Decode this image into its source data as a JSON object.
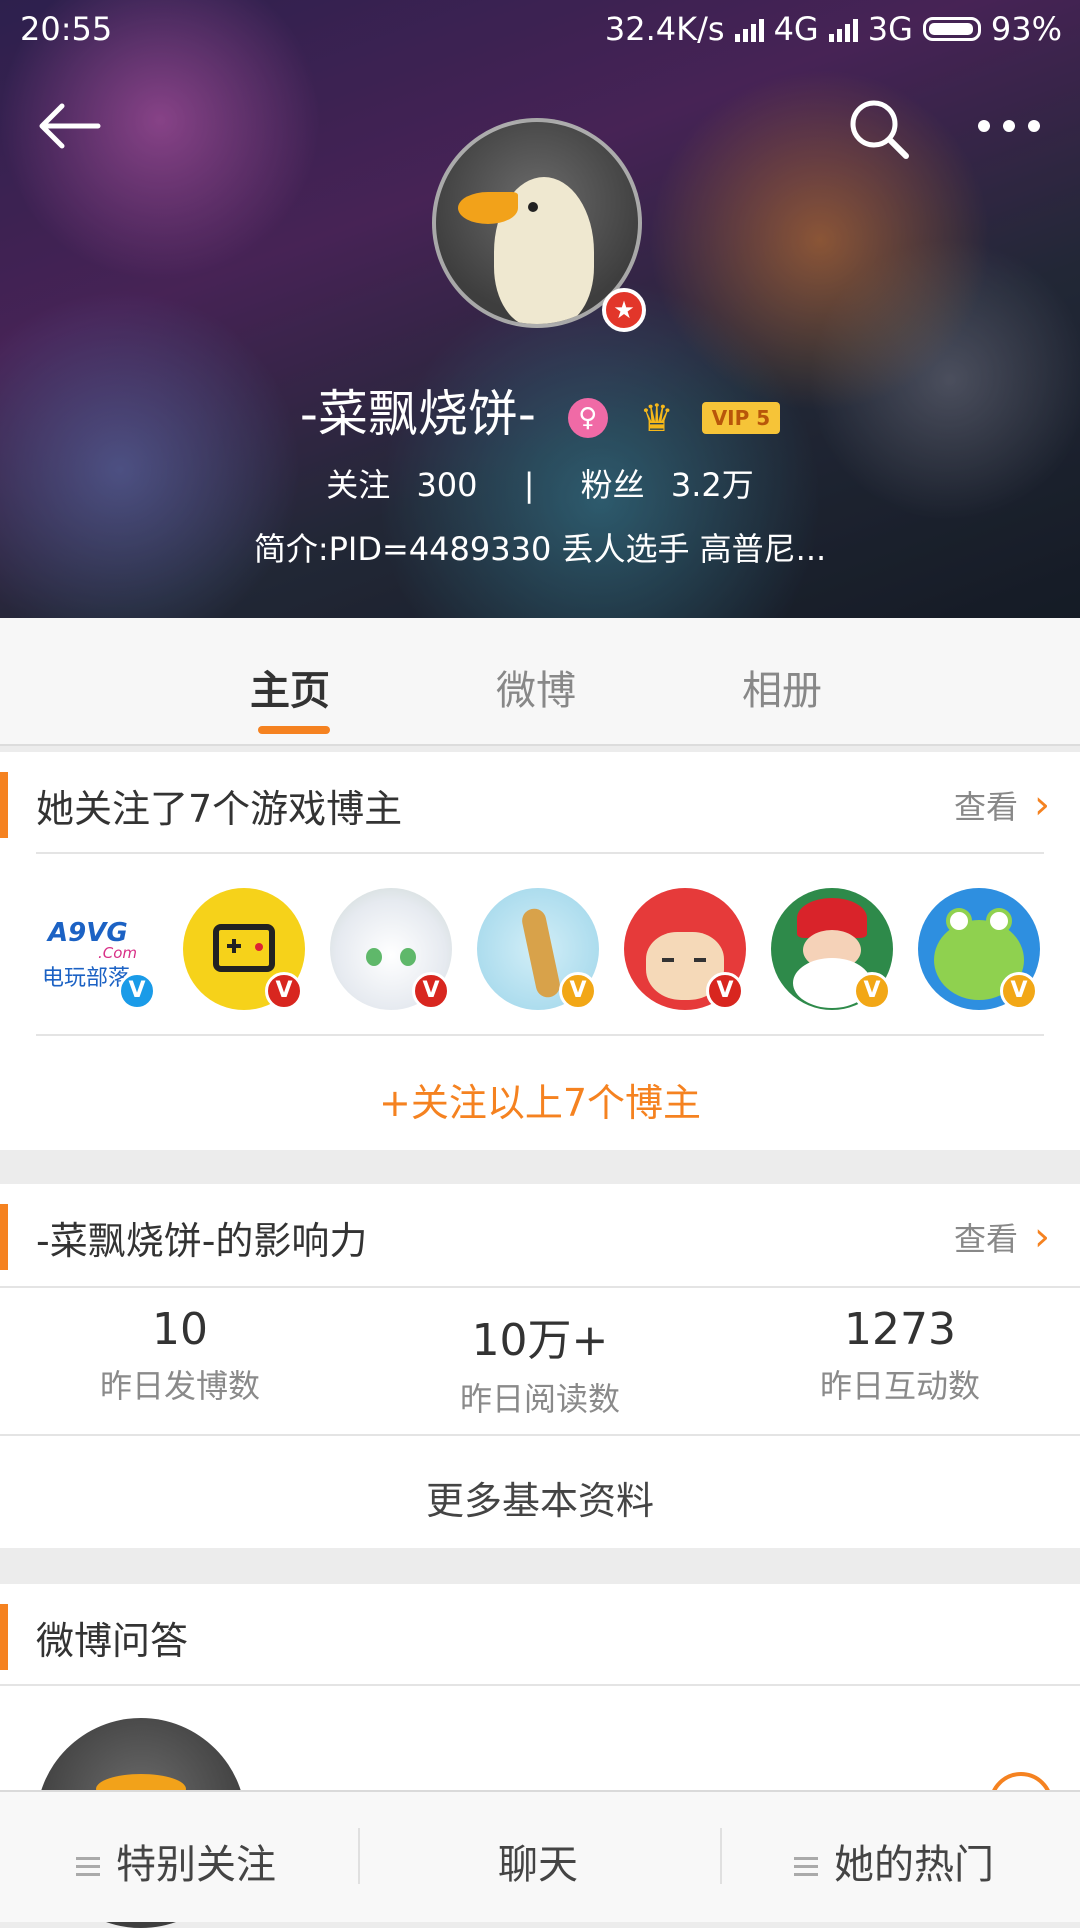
{
  "status_bar": {
    "time": "20:55",
    "speed": "32.4K/s",
    "net1": "4G",
    "net2": "3G",
    "battery": "93%"
  },
  "profile": {
    "name": "-菜飘烧饼-",
    "vip_label": "VIP 5",
    "following_label": "关注",
    "following_count": "300",
    "fans_label": "粉丝",
    "fans_count": "3.2万",
    "bio": "简介:PID=4489330 丢人选手 高普尼..."
  },
  "tabs": [
    {
      "label": "主页"
    },
    {
      "label": "微博"
    },
    {
      "label": "相册"
    }
  ],
  "follow_section": {
    "title": "她关注了7个游戏博主",
    "more": "查看",
    "cta": "+关注以上7个博主",
    "bloggers": [
      {
        "name": "A9VG",
        "badge": "blue"
      },
      {
        "name": "gamepad",
        "badge": "red"
      },
      {
        "name": "anime-girl",
        "badge": "red"
      },
      {
        "name": "dragon",
        "badge": "gold"
      },
      {
        "name": "red-cat",
        "badge": "red"
      },
      {
        "name": "santa",
        "badge": "gold"
      },
      {
        "name": "frog",
        "badge": "gold"
      }
    ],
    "logo_text_1": "A9VG",
    "logo_text_2": ".Com",
    "logo_text_3": "电玩部落"
  },
  "influence": {
    "title": "-菜飘烧饼-的影响力",
    "more": "查看",
    "metrics": [
      {
        "value": "10",
        "label": "昨日发博数"
      },
      {
        "value": "10万+",
        "label": "昨日阅读数"
      },
      {
        "value": "1273",
        "label": "昨日互动数"
      }
    ],
    "more_basic": "更多基本资料"
  },
  "qa": {
    "title": "微博问答"
  },
  "bottom_bar": [
    {
      "label": "特别关注"
    },
    {
      "label": "聊天"
    },
    {
      "label": "她的热门"
    }
  ],
  "colors": {
    "accent": "#f58220",
    "verified_blue": "#1a9be8",
    "verified_red": "#d8261f",
    "verified_gold": "#f2a716"
  },
  "icons": [
    "back-arrow-icon",
    "search-icon",
    "more-icon",
    "chevron-right-icon",
    "menu-icon",
    "crown-icon",
    "female-icon"
  ]
}
